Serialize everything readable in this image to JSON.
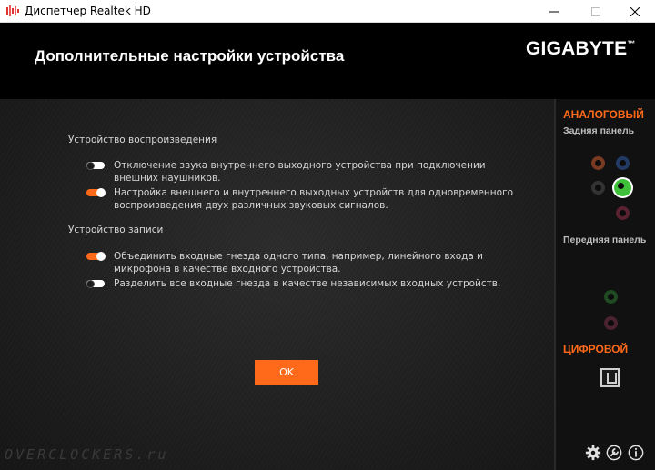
{
  "window": {
    "title": "Диспетчер Realtek HD"
  },
  "header": {
    "title": "Дополнительные настройки устройства",
    "brand": "GIGABYTE"
  },
  "playback": {
    "section_title": "Устройство воспроизведения",
    "options": [
      {
        "label": "Отключение звука внутреннего выходного устройства при подключении внешних наушников.",
        "enabled": false
      },
      {
        "label": "Настройка внешнего и внутреннего выходных устройств для одновременного воспроизведения двух различных звуковых сигналов.",
        "enabled": true
      }
    ]
  },
  "recording": {
    "section_title": "Устройство записи",
    "options": [
      {
        "label": "Объединить входные гнезда одного типа, например, линейного входа и микрофона в качестве входного устройства.",
        "enabled": true
      },
      {
        "label": "Разделить все входные гнезда в качестве независимых входных устройств.",
        "enabled": false
      }
    ]
  },
  "ok_label": "OK",
  "watermark": "OVERCLOCKERS.ru",
  "side": {
    "analog_label": "АНАЛОГОВЫЙ",
    "rear_label": "Задняя панель",
    "front_label": "Передняя панель",
    "digital_label": "ЦИФРОВОЙ",
    "rear_jacks": [
      {
        "color": "#7a3a22",
        "active": false
      },
      {
        "color": "#243a66",
        "active": false
      },
      {
        "color": "#333333",
        "active": false
      },
      {
        "color": "#3fbf3a",
        "active": true
      },
      {
        "color": "#5a2230",
        "active": false
      }
    ],
    "front_jacks": [
      {
        "color": "#1f4a22",
        "active": false
      },
      {
        "color": "#4a2230",
        "active": false
      }
    ]
  },
  "colors": {
    "accent": "#ff6a1a"
  }
}
